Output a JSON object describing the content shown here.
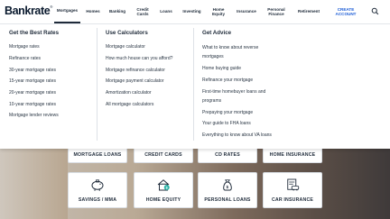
{
  "brand": {
    "logo": "Bankrate",
    "trademark": "®"
  },
  "nav": {
    "items": [
      {
        "label": "Mortgages"
      },
      {
        "label": "Homes"
      },
      {
        "label": "Banking"
      },
      {
        "label": "Credit Cards"
      },
      {
        "label": "Loans"
      },
      {
        "label": "Investing"
      },
      {
        "label": "Home Equity"
      },
      {
        "label": "Insurance"
      },
      {
        "label": "Personal Finance"
      },
      {
        "label": "Retirement"
      }
    ],
    "create_account": "CREATE ACCOUNT",
    "search_icon": "search-icon"
  },
  "dropdown": {
    "best_rates": {
      "title": "Get the Best Rates",
      "links": [
        "Mortgage rates",
        "Refinance rates",
        "30-year mortgage rates",
        "15-year mortgage rates",
        "20-year mortgage rates",
        "10-year mortgage rates",
        "Mortgage lender reviews"
      ]
    },
    "calculators": {
      "title": "Use Calculators",
      "links": [
        "Mortgage calculator",
        "How much house can you afford?",
        "Mortgage refinance calculator",
        "Mortgage payment calculator",
        "Amortization calculator",
        "All mortgage calculators"
      ]
    },
    "advice": {
      "title": "Get Advice",
      "links": [
        "What to know about reverse mortgages",
        "Home buying guide",
        "Refinance your mortgage",
        "First-time homebuyer loans and programs",
        "Prepaying your mortgage",
        "Your guide to FHA loans",
        "Everything to know about VA loans"
      ]
    }
  },
  "cards": {
    "row1": [
      "MORTGAGE LOANS",
      "CREDIT CARDS",
      "CD RATES",
      "HOME INSURANCE"
    ],
    "row2": [
      "SAVINGS / MMA",
      "HOME EQUITY",
      "PERSONAL LOANS",
      "CAR INSURANCE"
    ]
  },
  "colors": {
    "accent": "#1a5bd6",
    "text": "#1f2b3a"
  }
}
